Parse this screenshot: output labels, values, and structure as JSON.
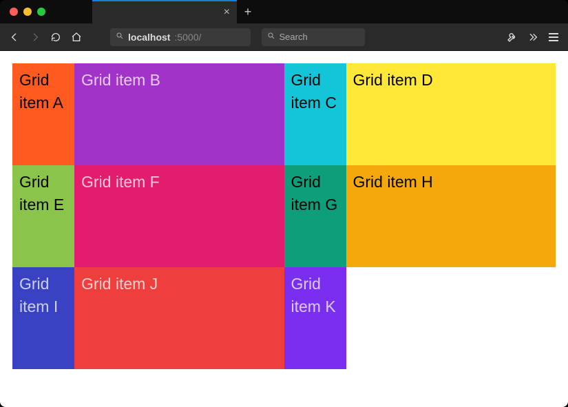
{
  "browser": {
    "tab_close_glyph": "×",
    "new_tab_glyph": "+",
    "url": {
      "host": "localhost",
      "rest": ":5000/"
    },
    "search_placeholder": "Search"
  },
  "grid": {
    "cells": [
      {
        "label": "Grid item A",
        "bg": "#ff5a1f",
        "light": false
      },
      {
        "label": "Grid item B",
        "bg": "#a233c9",
        "light": true
      },
      {
        "label": "Grid item C",
        "bg": "#14c4d8",
        "light": false
      },
      {
        "label": "Grid item D",
        "bg": "#ffe838",
        "light": false
      },
      {
        "label": "Grid item E",
        "bg": "#8ac44a",
        "light": false
      },
      {
        "label": "Grid item F",
        "bg": "#e21d6e",
        "light": true
      },
      {
        "label": "Grid item G",
        "bg": "#0f9e7a",
        "light": false
      },
      {
        "label": "Grid item H",
        "bg": "#f5a80b",
        "light": false
      },
      {
        "label": "Grid item I",
        "bg": "#3a42c4",
        "light": true
      },
      {
        "label": "Grid item J",
        "bg": "#ee3e3e",
        "light": true
      },
      {
        "label": "Grid item K",
        "bg": "#7a2ff0",
        "light": true
      }
    ]
  }
}
